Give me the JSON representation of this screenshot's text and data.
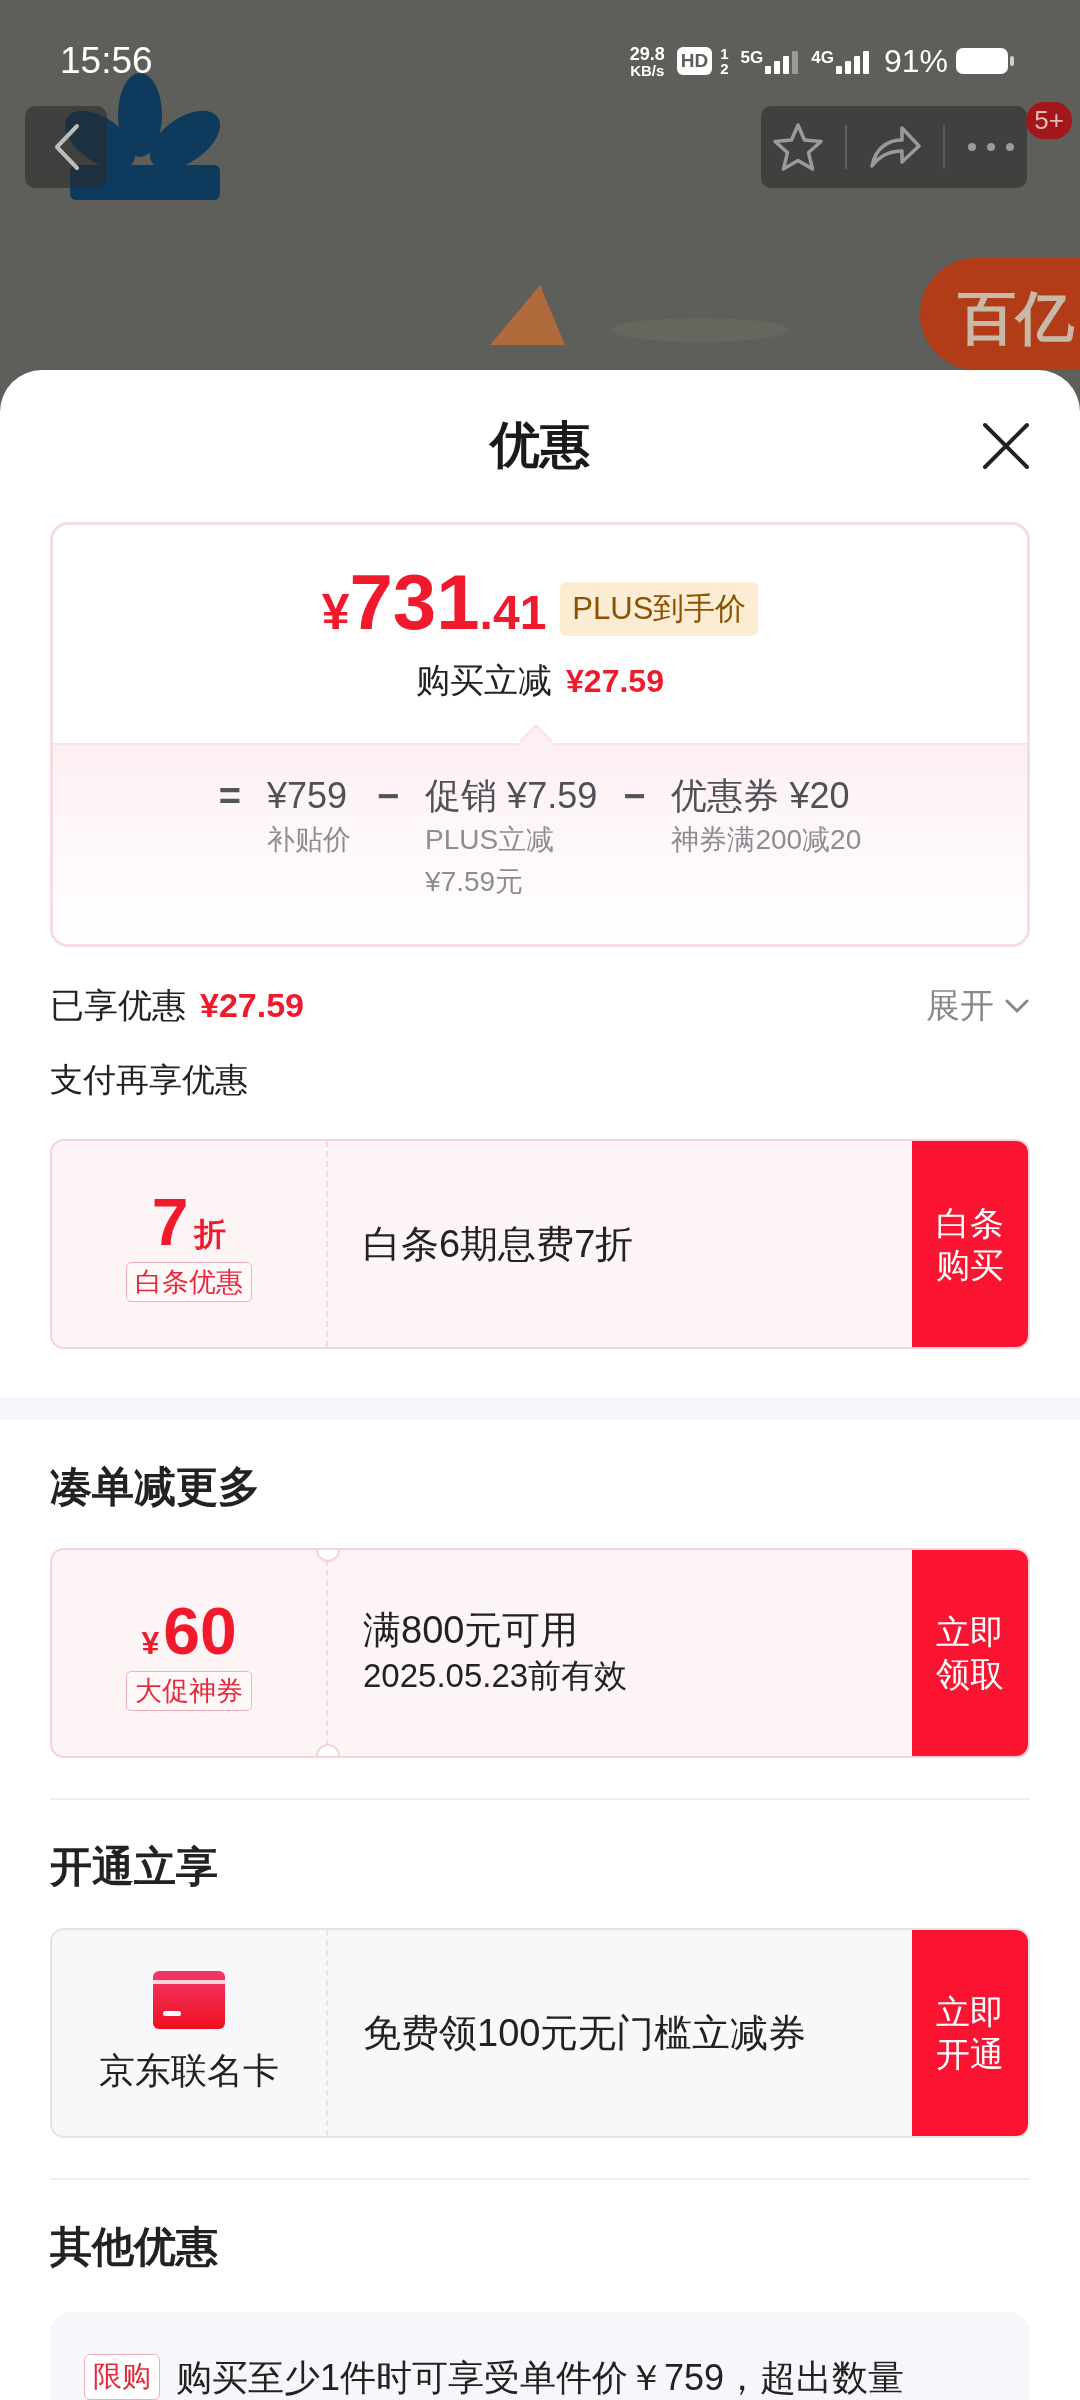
{
  "status_bar": {
    "time": "15:56",
    "speed_value": "29.8",
    "speed_unit": "KB/s",
    "hd": "HD",
    "sims": [
      "1",
      "2"
    ],
    "networks": [
      "5G",
      "4G"
    ],
    "battery": "91%"
  },
  "top_bar": {
    "badge": "5+"
  },
  "promo_badge": {
    "text": "百亿"
  },
  "sheet": {
    "title": "优惠"
  },
  "price_card": {
    "currency": "¥",
    "price_main": "731",
    "price_decimal": ".41",
    "tag": "PLUS到手价",
    "saving_label": "购买立减",
    "saving": "¥27.59",
    "breakdown": [
      {
        "operator": "=",
        "amount": "¥759",
        "notes": [
          "补贴价"
        ]
      },
      {
        "operator": "−",
        "label": "促销",
        "amount": "¥7.59",
        "notes": [
          "PLUS立减",
          "¥7.59元"
        ]
      },
      {
        "operator": "−",
        "label": "优惠券",
        "amount": "¥20",
        "notes": [
          "神券满200减20"
        ]
      }
    ]
  },
  "enjoyed": {
    "label": "已享优惠",
    "amount": "¥27.59",
    "toggle": "展开",
    "expanded": false
  },
  "sections": [
    {
      "kind": "sub",
      "title": "支付再享优惠",
      "cards": [
        {
          "kind": "discount",
          "value": "7",
          "unit": "折",
          "tag": "白条优惠",
          "lines": [
            "白条6期息费7折"
          ],
          "button": "白条购买"
        }
      ]
    },
    {
      "kind": "main",
      "title": "凑单减更多",
      "cards": [
        {
          "kind": "coupon",
          "currency": "¥",
          "value": "60",
          "tag": "大促神券",
          "lines": [
            "满800元可用",
            "2025.05.23前有效"
          ],
          "button": "立即领取"
        }
      ]
    },
    {
      "kind": "main",
      "title": "开通立享",
      "cards": [
        {
          "kind": "member_card",
          "label": "京东联名卡",
          "lines": [
            "免费领100元无门槛立减券"
          ],
          "button": "立即开通"
        }
      ]
    },
    {
      "kind": "main",
      "title": "其他优惠",
      "notices": [
        {
          "tag": "限购",
          "text": "购买至少1件时可享受单件价￥759，超出数量"
        }
      ]
    }
  ]
}
